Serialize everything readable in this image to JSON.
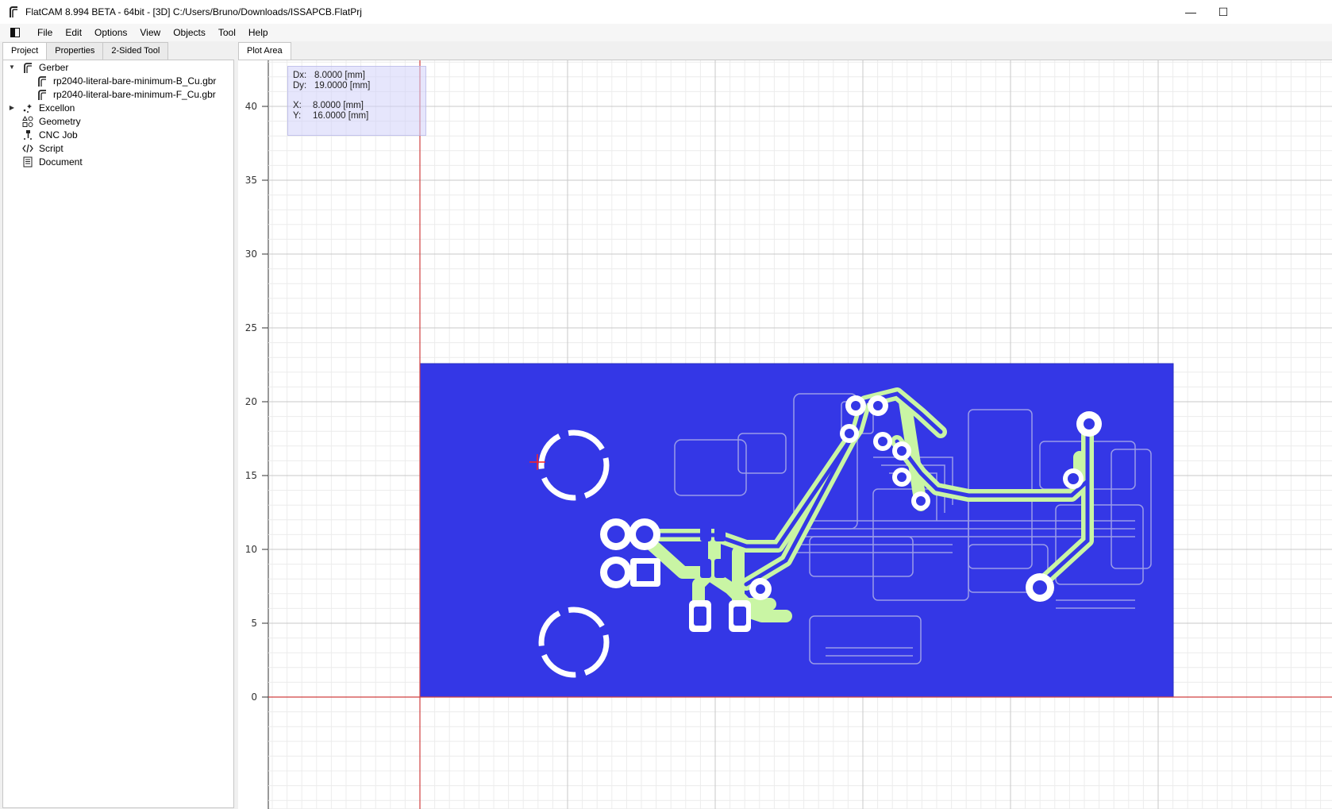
{
  "window": {
    "title": "FlatCAM 8.994 BETA - 64bit - [3D]    C:/Users/Bruno/Downloads/ISSAPCB.FlatPrj",
    "app_icon": "flatcam-logo-icon",
    "controls": {
      "minimize": "—",
      "maximize": "☐"
    }
  },
  "menu": {
    "toggle_icon": "panel-toggle-icon",
    "items": [
      "File",
      "Edit",
      "Options",
      "View",
      "Objects",
      "Tool",
      "Help"
    ]
  },
  "left_tabs": [
    "Project",
    "Properties",
    "2-Sided Tool"
  ],
  "tree": {
    "gerber": {
      "label": "Gerber",
      "expanded": true,
      "children": [
        "rp2040-literal-bare-minimum-B_Cu.gbr",
        "rp2040-literal-bare-minimum-F_Cu.gbr"
      ]
    },
    "excellon": {
      "label": "Excellon",
      "expanded": false
    },
    "geometry": {
      "label": "Geometry"
    },
    "cncjob": {
      "label": "CNC Job"
    },
    "script": {
      "label": "Script"
    },
    "document": {
      "label": "Document"
    }
  },
  "plot_tab": "Plot Area",
  "coords": {
    "dx_label": "Dx:",
    "dx_value": "8.0000 [mm]",
    "dy_label": "Dy:",
    "dy_value": "19.0000 [mm]",
    "x_label": "X:",
    "x_value": "8.0000 [mm]",
    "y_label": "Y:",
    "y_value": "16.0000 [mm]"
  },
  "y_axis_ticks": [
    "40",
    "35",
    "30",
    "25",
    "20",
    "15",
    "10",
    "5",
    "0"
  ],
  "colors": {
    "board_fill": "#3437e6",
    "copper_trace": "#c9f5a4",
    "axis_red": "#d04040",
    "cursor": "#ff2020"
  }
}
